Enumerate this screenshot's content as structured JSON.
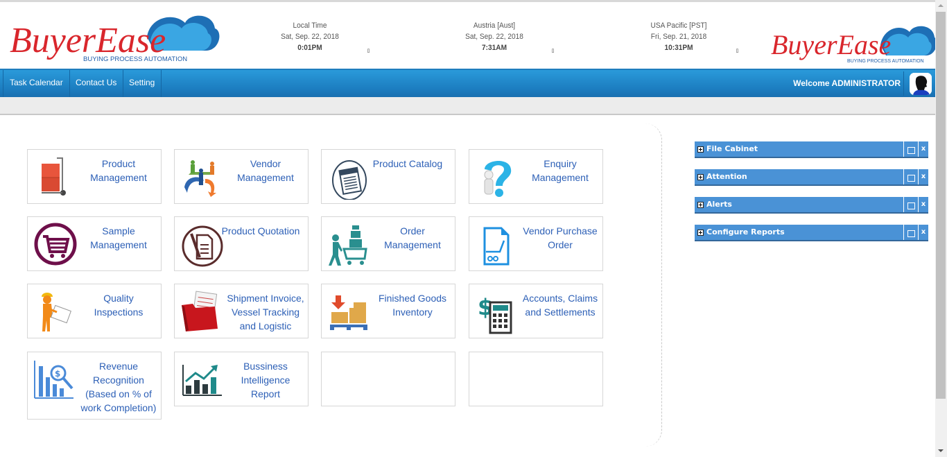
{
  "header": {
    "logo": {
      "brand": "BuyerEase",
      "tagline": "BUYING PROCESS AUTOMATION",
      "brand_color": "#d9262c",
      "cloud_color": "#2a8fd6"
    },
    "clocks": [
      {
        "name": "Local Time",
        "date": "Sat, Sep. 22, 2018",
        "time": "0:01PM",
        "indicator": "▯"
      },
      {
        "name": "Austria [Aust]",
        "date": "Sat, Sep. 22, 2018",
        "time": "7:31AM",
        "indicator": "▯"
      },
      {
        "name": "USA Pacific [PST]",
        "date": "Fri, Sep. 21, 2018",
        "time": "10:31PM",
        "indicator": "▯"
      }
    ]
  },
  "navbar": {
    "items": [
      {
        "label": "Task Calendar"
      },
      {
        "label": "Contact Us"
      },
      {
        "label": "Setting"
      }
    ],
    "welcome": "Welcome ADMINISTRATOR",
    "avatar_icon": "user-avatar-icon",
    "color": "#1f85c9"
  },
  "tiles": [
    {
      "label": "Product Management",
      "icon": "hand-truck-boxes-icon"
    },
    {
      "label": "Vendor Management",
      "icon": "vendor-cycle-people-icon"
    },
    {
      "label": "Product Catalog",
      "icon": "catalog-icon"
    },
    {
      "label": "Enquiry Management",
      "icon": "question-mark-figure-icon"
    },
    {
      "label": "Sample Management",
      "icon": "shopping-cart-circle-icon"
    },
    {
      "label": "Product Quotation",
      "icon": "quotation-document-icon"
    },
    {
      "label": "Order Management",
      "icon": "person-pushing-cart-icon"
    },
    {
      "label": "Vendor Purchase Order",
      "icon": "purchase-order-cart-icon"
    },
    {
      "label": "Quality Inspections",
      "icon": "inspector-clipboard-icon"
    },
    {
      "label": "Shipment Invoice, Vessel Tracking and Logistic",
      "icon": "red-folder-invoice-icon"
    },
    {
      "label": "Finished Goods Inventory",
      "icon": "inventory-boxes-icon"
    },
    {
      "label": "Accounts, Claims and Settlements",
      "icon": "calculator-dollar-icon"
    },
    {
      "label": "Revenue Recognition (Based on % of work Completion)",
      "icon": "revenue-chart-magnifier-icon"
    },
    {
      "label": "Bussiness Intelligence Report",
      "icon": "bi-chart-icon"
    },
    {
      "label": "",
      "icon": ""
    },
    {
      "label": "",
      "icon": ""
    }
  ],
  "widgets": [
    {
      "title": "File Cabinet",
      "close": "x"
    },
    {
      "title": "Attention",
      "close": "x"
    },
    {
      "title": "Alerts",
      "close": "x"
    },
    {
      "title": "Configure Reports",
      "close": "x"
    }
  ]
}
